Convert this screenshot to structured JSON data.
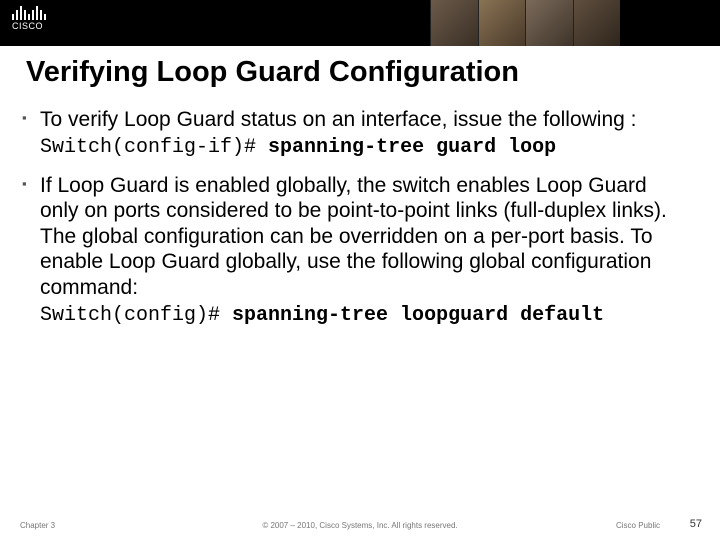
{
  "header": {
    "logo_text": "CISCO"
  },
  "title": "Verifying Loop Guard Configuration",
  "bullets": [
    {
      "text": "To verify Loop Guard status on an interface, issue the following :",
      "code_prompt": "Switch(config-if)# ",
      "code_cmd": "spanning-tree guard loop"
    },
    {
      "text": "If Loop Guard is enabled globally, the switch enables Loop Guard only on ports considered to be point-to-point links (full-duplex links). The global configuration can be overridden on a per-port basis. To enable Loop Guard globally, use the following global configuration command:",
      "code_prompt": "Switch(config)# ",
      "code_cmd": "spanning-tree loopguard default"
    }
  ],
  "footer": {
    "chapter": "Chapter 3",
    "copyright": "© 2007 – 2010, Cisco Systems, Inc. All rights reserved.",
    "classification": "Cisco Public",
    "page": "57"
  }
}
